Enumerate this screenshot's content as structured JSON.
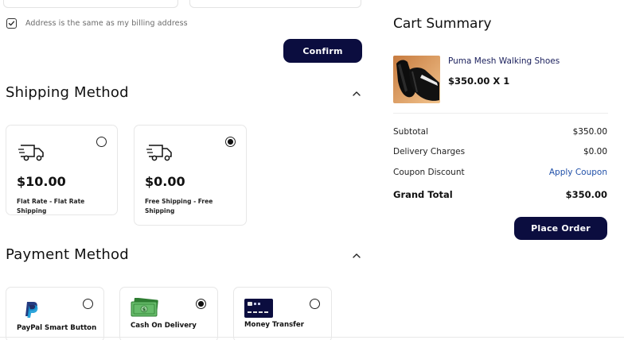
{
  "billing": {
    "same_address_label": "Address is the same as my billing address",
    "confirm_label": "Confirm"
  },
  "shipping": {
    "title": "Shipping Method",
    "options": [
      {
        "price": "$10.00",
        "description": "Flat Rate - Flat Rate Shipping",
        "selected": false
      },
      {
        "price": "$0.00",
        "description": "Free Shipping - Free Shipping",
        "selected": true
      }
    ]
  },
  "payment": {
    "title": "Payment Method",
    "options": [
      {
        "label": "PayPal Smart Button",
        "icon": "paypal-icon",
        "selected": false
      },
      {
        "label": "Cash On Delivery",
        "icon": "cash-icon",
        "selected": true
      },
      {
        "label": "Money Transfer",
        "icon": "bank-card-icon",
        "selected": false
      }
    ]
  },
  "summary": {
    "title": "Cart Summary",
    "product": {
      "name": "Puma Mesh Walking Shoes",
      "price_qty": "$350.00 X 1"
    },
    "rows": [
      {
        "label": "Subtotal",
        "value": "$350.00"
      },
      {
        "label": "Delivery Charges",
        "value": "$0.00"
      },
      {
        "label": "Coupon Discount",
        "value": "Apply Coupon"
      },
      {
        "label": "Grand Total",
        "value": "$350.00"
      }
    ],
    "place_order_label": "Place Order"
  },
  "colors": {
    "primary": "#0b0d3f",
    "link": "#1f4fa8",
    "cash_green": "#4caf50"
  }
}
